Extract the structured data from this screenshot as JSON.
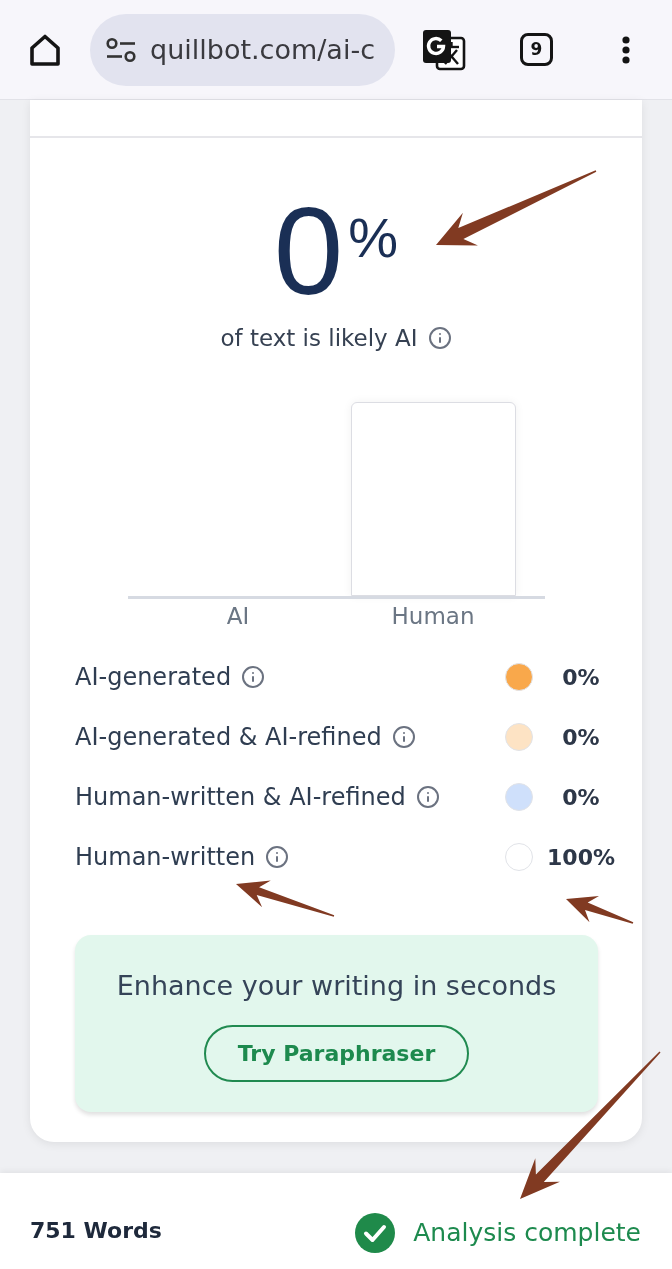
{
  "browser": {
    "url": "quillbot.com/ai-c",
    "tab_count": "9"
  },
  "result": {
    "score": "0",
    "unit": "%",
    "caption": "of text is likely AI"
  },
  "chart": {
    "categories": [
      "AI",
      "Human"
    ]
  },
  "breakdown": [
    {
      "label": "AI-generated",
      "color": "#f9a84b",
      "value": "0%"
    },
    {
      "label": "AI-generated & AI-refined",
      "color": "#fde3c4",
      "value": "0%"
    },
    {
      "label": "Human-written & AI-refined",
      "color": "#cfe0fb",
      "value": "0%"
    },
    {
      "label": "Human-written",
      "color": "#ffffff",
      "value": "100%"
    }
  ],
  "promo": {
    "text": "Enhance your writing in seconds",
    "button": "Try Paraphraser"
  },
  "footer": {
    "word_count": "751 Words",
    "status": "Analysis complete"
  }
}
